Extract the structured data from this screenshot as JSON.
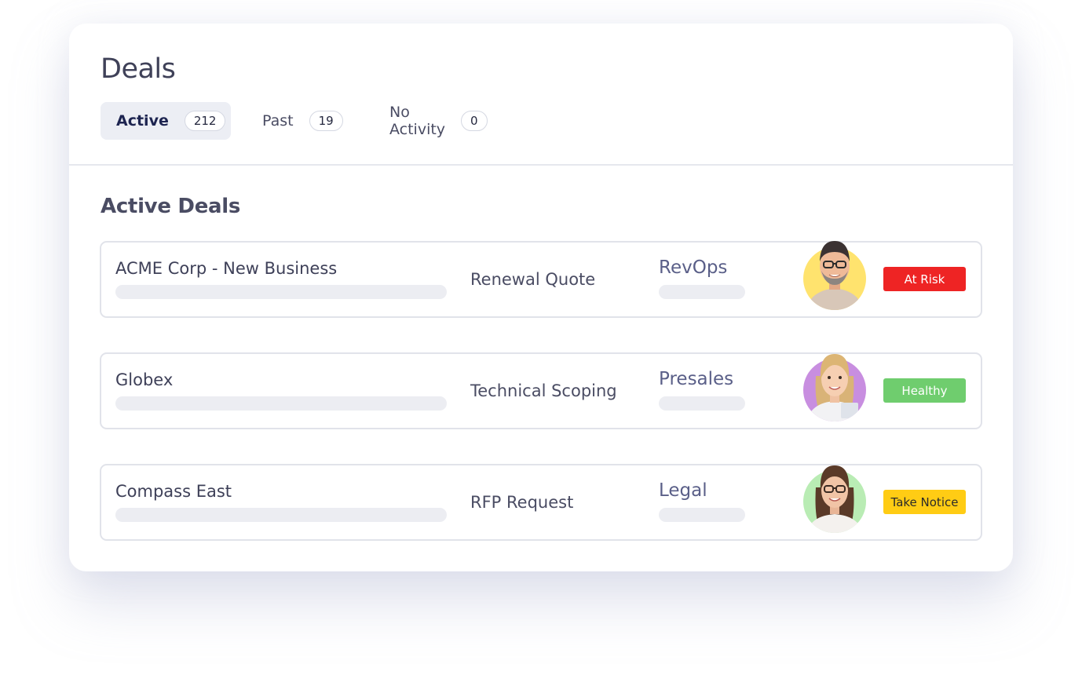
{
  "page": {
    "title": "Deals",
    "section_title": "Active Deals"
  },
  "tabs": [
    {
      "label": "Active",
      "count": "212",
      "active": true
    },
    {
      "label": "Past",
      "count": "19",
      "active": false
    },
    {
      "label": "No Activity",
      "count": "0",
      "active": false
    }
  ],
  "deals": [
    {
      "name": "ACME Corp - New Business",
      "stage": "Renewal Quote",
      "team": "RevOps",
      "avatar": "avatar-man-glasses",
      "status": "At Risk",
      "status_bg": "#ee2424",
      "status_fg": "#ffffff"
    },
    {
      "name": "Globex",
      "stage": "Technical Scoping",
      "team": "Presales",
      "avatar": "avatar-woman-blonde",
      "status": "Healthy",
      "status_bg": "#6fcd6e",
      "status_fg": "#ffffff"
    },
    {
      "name": "Compass East",
      "stage": "RFP Request",
      "team": "Legal",
      "avatar": "avatar-woman-glasses",
      "status": "Take Notice",
      "status_bg": "#ffcc14",
      "status_fg": "#2a2a2a"
    }
  ],
  "colors": {
    "avatar_bg_1": "#ffe36e",
    "avatar_bg_2": "#c88ee0",
    "avatar_bg_3": "#b9ecb4"
  }
}
